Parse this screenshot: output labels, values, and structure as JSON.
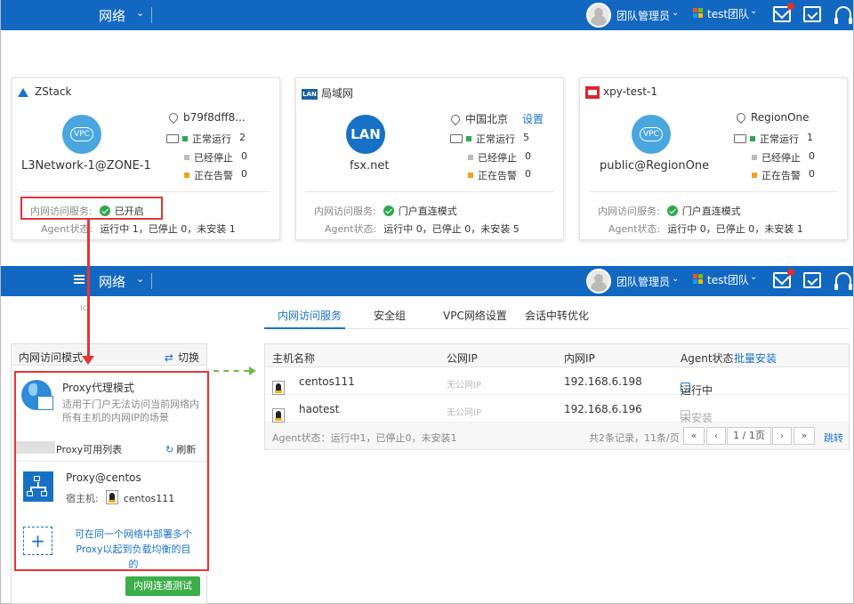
{
  "topbar": {
    "title": "网络",
    "user_name": "团队管理员",
    "team_name": "test团队",
    "colors": {
      "bar": "#1268c0",
      "alert": "#e03030"
    }
  },
  "cards": [
    {
      "title": "ZStack",
      "circle_label": "VPC",
      "network_name": "L3Network-1@ZONE-1",
      "location": "b79f8dff8...",
      "location_action": "",
      "running_label": "正常运行",
      "running": "2",
      "stopped_label": "已经停止",
      "stopped": "0",
      "alarm_label": "正在告警",
      "alarm": "0",
      "service_label": "内网访问服务:",
      "service_value": "已开启",
      "agent_label": "Agent状态:",
      "agent_value": "运行中 1，已停止 0，未安装 1"
    },
    {
      "title": "局域网",
      "circle_label": "LAN",
      "network_name": "fsx.net",
      "location": "中国北京",
      "location_action": "设置",
      "running_label": "正常运行",
      "running": "5",
      "stopped_label": "已经停止",
      "stopped": "0",
      "alarm_label": "正在告警",
      "alarm": "0",
      "service_label": "内网访问服务:",
      "service_value": "门户直连模式",
      "agent_label": "Agent状态:",
      "agent_value": "运行中 0，已停止 0，未安装 5"
    },
    {
      "title": "xpy-test-1",
      "circle_label": "VPC",
      "network_name": "public@RegionOne",
      "location": "RegionOne",
      "location_action": "",
      "running_label": "正常运行",
      "running": "1",
      "stopped_label": "已经停止",
      "stopped": "0",
      "alarm_label": "正在告警",
      "alarm": "0",
      "service_label": "内网访问服务:",
      "service_value": "门户直连模式",
      "agent_label": "Agent状态:",
      "agent_value": "运行中 0，已停止 0，未安装 1"
    }
  ],
  "status_colors": {
    "running": "#2fa84f",
    "stopped": "#bbbbbb",
    "alarm": "#f5a020"
  },
  "tabs": [
    "内网访问服务",
    "安全组",
    "VPC网络设置",
    "会话中转优化"
  ],
  "faint_text": "Ict",
  "left_panel": {
    "title": "内网访问模式",
    "switch_label": "切换",
    "mode_title": "Proxy代理模式",
    "mode_desc": "适用于门户无法访问当前网络内所有主机的内网IP的场景",
    "list_title": "Proxy可用列表",
    "refresh_label": "刷新",
    "proxy_name": "Proxy@centos",
    "host_label": "宿主机:",
    "host_value": "centos111",
    "add_hint": "可在同一个网络中部署多个Proxy以起到负载均衡的目的",
    "test_button": "内网连通测试"
  },
  "table": {
    "headers": {
      "host": "主机名称",
      "public_ip": "公网IP",
      "private_ip": "内网IP",
      "agent": "Agent状态",
      "batch": "批量安装"
    },
    "rows": [
      {
        "host": "centos111",
        "public_ip": "无公网IP",
        "private_ip": "192.168.6.198",
        "agent": "运行中"
      },
      {
        "host": "haotest",
        "public_ip": "无公网IP",
        "private_ip": "192.168.6.196",
        "agent": "未安装"
      }
    ],
    "footer_agent": "Agent状态：运行中1，已停止0，未安装1",
    "records": "共2条记录，11条/页",
    "page": "1 / 1页",
    "jump": "跳转"
  }
}
